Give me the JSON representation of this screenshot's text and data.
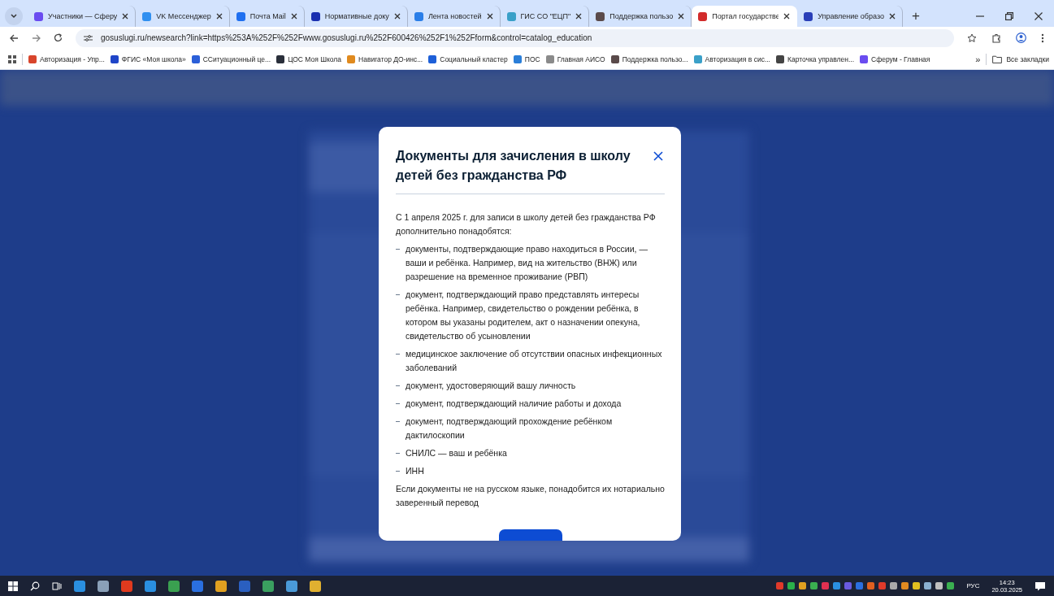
{
  "browser": {
    "tabs": [
      {
        "title": "Участники — Сферу",
        "color": "#6a4cf0",
        "selected": false
      },
      {
        "title": "VK Мессенджер",
        "color": "#2f8ff0",
        "selected": false
      },
      {
        "title": "Почта Mail",
        "color": "#1e6ff0",
        "selected": false
      },
      {
        "title": "Нормативные доку",
        "color": "#1a2fb0",
        "selected": false
      },
      {
        "title": "Лента новостей",
        "color": "#2a7ee8",
        "selected": false
      },
      {
        "title": "ГИС СО \"ЕЦП\"",
        "color": "#3aa0c8",
        "selected": false
      },
      {
        "title": "Поддержка пользо",
        "color": "#5a4a4a",
        "selected": false
      },
      {
        "title": "Портал государстве",
        "color": "#d22b2b",
        "selected": true
      },
      {
        "title": "Управление образо",
        "color": "#2a3fb8",
        "selected": false
      }
    ],
    "new_tab": "+",
    "address": "gosuslugi.ru/newsearch?link=https%253A%252F%252Fwww.gosuslugi.ru%252F600426%252F1%252Fform&control=catalog_education",
    "bookmarks": [
      {
        "title": "Авторизация - Упр...",
        "color": "#d8452c"
      },
      {
        "title": "ФГИС «Моя школа»",
        "color": "#1f45c8"
      },
      {
        "title": "ССитуационный це...",
        "color": "#2b5fd8"
      },
      {
        "title": "ЦОС Моя Школа",
        "color": "#2a2f3a"
      },
      {
        "title": "Навигатор ДО-инс...",
        "color": "#e08a1e"
      },
      {
        "title": "Социальный кластер",
        "color": "#1d5fd8"
      },
      {
        "title": "ПОС",
        "color": "#2a7ed8"
      },
      {
        "title": "Главная АИСО",
        "color": "#8a8a8a"
      },
      {
        "title": "Поддержка пользо...",
        "color": "#5a4a4a"
      },
      {
        "title": "Авторизация в сис...",
        "color": "#3aa0c8"
      },
      {
        "title": "Карточка управлен...",
        "color": "#444444"
      },
      {
        "title": "Сферум - Главная",
        "color": "#6a4cf0"
      }
    ],
    "more_bookmarks": "»",
    "all_bookmarks": "Все закладки"
  },
  "dialog": {
    "title": "Документы для зачисления в школу детей без гражданства РФ",
    "intro": "С 1 апреля 2025 г. для записи в школу детей без гражданства РФ дополнительно понадобятся:",
    "items": [
      "документы, подтверждающие право находиться в России, — ваши и ребёнка. Например, вид на жительство (ВНЖ) или разрешение на временное проживание (РВП)",
      "документ, подтверждающий право представлять интересы ребёнка. Например, свидетельство о рождении ребёнка, в котором вы указаны родителем, акт о назначении опекуна, свидетельство об усыновлении",
      "медицинское заключение об отсутствии опасных инфекционных заболеваний",
      "документ, удостоверяющий вашу личность",
      "документ, подтверждающий наличие работы и дохода",
      "документ, подтверждающий прохождение ребёнком дактилоскопии",
      "СНИЛС — ваш и ребёнка",
      "ИНН"
    ],
    "note": "Если документы не на русском языке, понадобится их нотариально заверенный перевод"
  },
  "taskbar": {
    "language": "РУС",
    "time": "14:23",
    "date": "20.03.2025"
  }
}
